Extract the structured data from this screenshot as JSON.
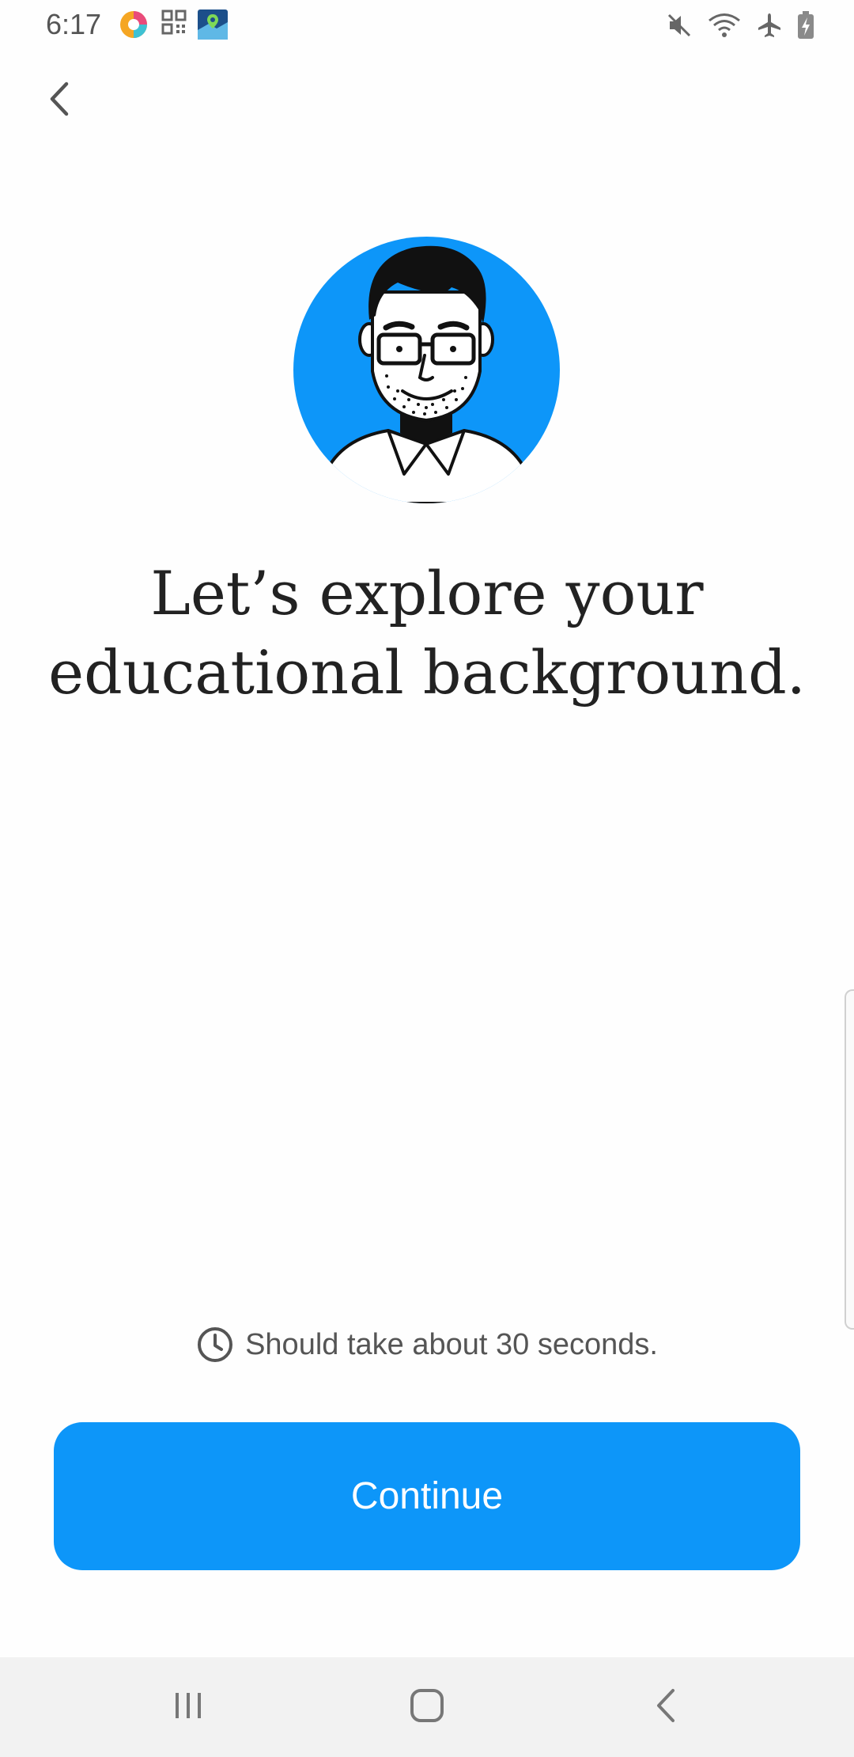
{
  "status_bar": {
    "time": "6:17",
    "app_icons": [
      "colorful-app-icon",
      "qr-code-icon",
      "maps-icon"
    ],
    "right_icons": [
      "mute-icon",
      "wifi-icon",
      "airplane-mode-icon",
      "battery-charging-icon"
    ]
  },
  "header": {
    "back_icon": "chevron-left-icon"
  },
  "main": {
    "avatar": "avatar-illustration",
    "heading_line1": "Let’s explore your",
    "heading_line2": "educational background.",
    "time_hint": "Should take about 30 seconds.",
    "time_icon": "clock-icon",
    "continue_label": "Continue"
  },
  "colors": {
    "accent": "#0d96f9",
    "text": "#222222",
    "muted": "#555555",
    "nav_bar": "#f2f2f2"
  },
  "nav_bar": {
    "icons": [
      "recent-apps-icon",
      "home-icon",
      "back-icon"
    ]
  }
}
